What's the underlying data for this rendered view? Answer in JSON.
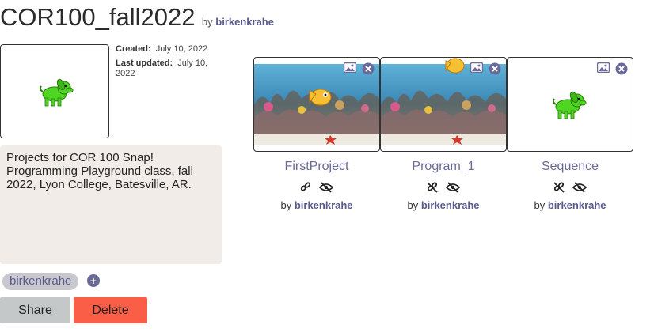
{
  "collection": {
    "title": "COR100_fall2022",
    "by_prefix": "by",
    "author": "birkenkrahe",
    "created_label": "Created:",
    "created_value": "July 10, 2022",
    "updated_label": "Last updated:",
    "updated_value_1": "July 10,",
    "updated_value_2": "2022",
    "description_lines": [
      "Projects for COR 100 Snap!",
      "Programming Playground class, fall",
      "2022, Lyon College, Batesville, AR."
    ],
    "tag": "birkenkrahe"
  },
  "actions": {
    "share": "Share",
    "delete": "Delete"
  },
  "projects": [
    {
      "name": "FirstProject",
      "by_prefix": "by",
      "author": "birkenkrahe",
      "thumbnail": "aquarium",
      "link_state": "linked-icon",
      "visibility": "hidden-icon"
    },
    {
      "name": "Program_1",
      "by_prefix": "by",
      "author": "birkenkrahe",
      "thumbnail": "aquarium",
      "link_state": "unlinked-icon",
      "visibility": "hidden-icon"
    },
    {
      "name": "Sequence",
      "by_prefix": "by",
      "author": "birkenkrahe",
      "thumbnail": "dog",
      "link_state": "unlinked-icon",
      "visibility": "hidden-icon"
    }
  ],
  "colors": {
    "accent": "#6a6a9a",
    "delete": "#fa5e46",
    "share": "#c4c8c8",
    "description_bg": "#f2ece9"
  }
}
